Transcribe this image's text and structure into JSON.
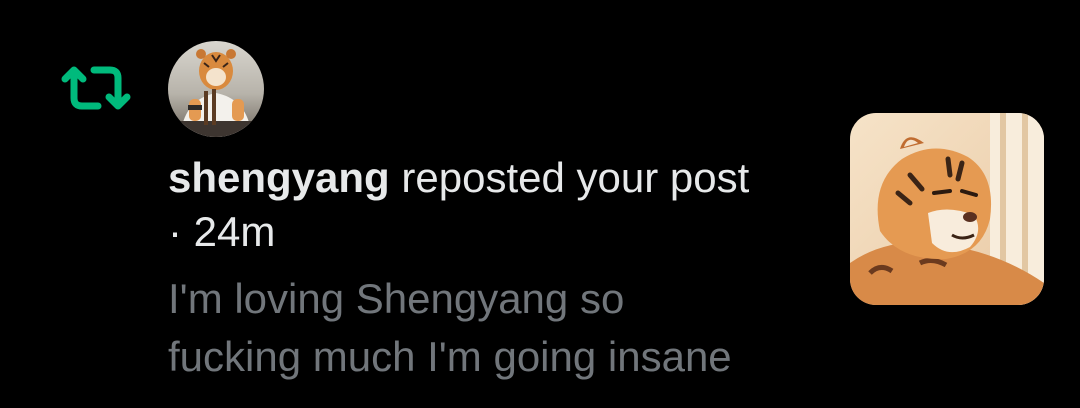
{
  "notification": {
    "username": "shengyang",
    "action_text": " reposted your post",
    "separator": "·",
    "timestamp": "24m",
    "post_lines": [
      "I'm loving Shengyang so",
      "fucking much I'm going insane"
    ],
    "icon": "repost-icon",
    "colors": {
      "background": "#000000",
      "primary_text": "#e7e9ea",
      "secondary_text": "#71767b",
      "repost_green": "#00ba7c"
    }
  }
}
